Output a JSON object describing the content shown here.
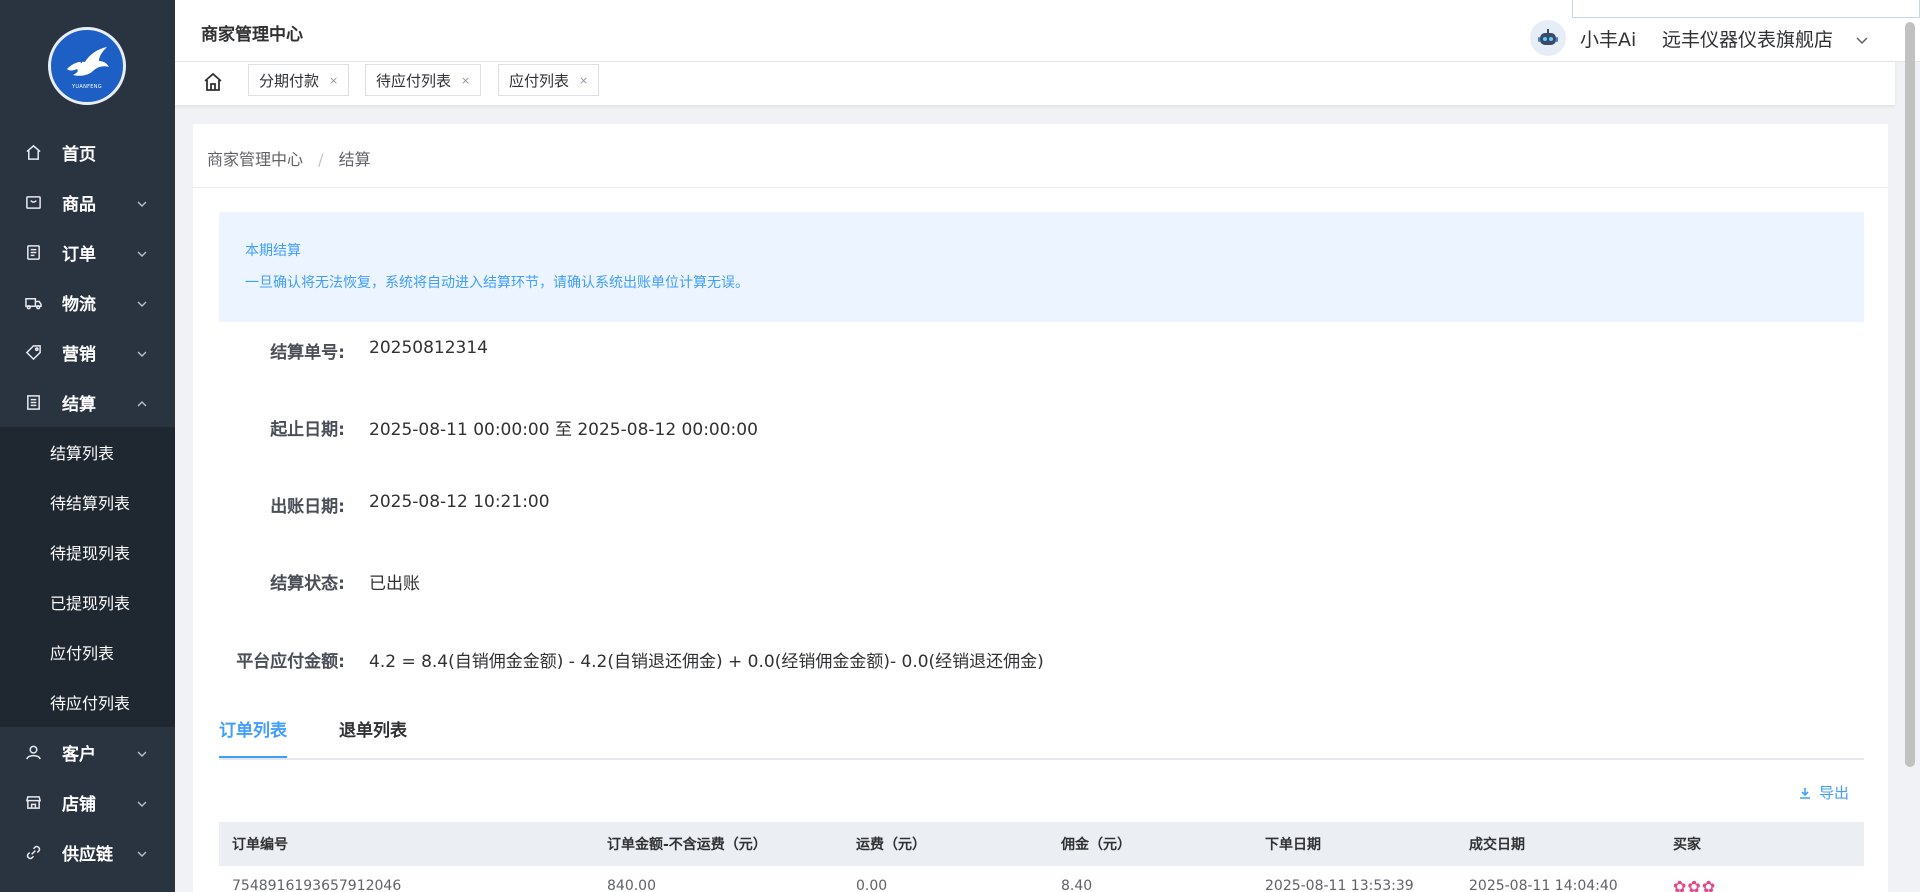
{
  "header": {
    "title": "商家管理中心",
    "ai_label": "小丰Ai",
    "store_name": "远丰仪器仪表旗舰店"
  },
  "logo": {
    "text": "YUANFENG"
  },
  "sidebar": {
    "items": [
      {
        "label": "首页",
        "icon": "home-icon"
      },
      {
        "label": "商品",
        "icon": "product-icon"
      },
      {
        "label": "订单",
        "icon": "order-icon"
      },
      {
        "label": "物流",
        "icon": "truck-icon"
      },
      {
        "label": "营销",
        "icon": "tag-icon"
      },
      {
        "label": "结算",
        "icon": "settlement-icon",
        "expanded": true
      },
      {
        "label": "客户",
        "icon": "user-icon"
      },
      {
        "label": "店铺",
        "icon": "store-icon"
      },
      {
        "label": "供应链",
        "icon": "link-icon"
      }
    ],
    "settlement_sub": [
      "结算列表",
      "待结算列表",
      "待提现列表",
      "已提现列表",
      "应付列表",
      "待应付列表"
    ]
  },
  "tabs_bar": {
    "tags": [
      "分期付款",
      "待应付列表",
      "应付列表"
    ],
    "close_glyph": "×"
  },
  "breadcrumb": {
    "root": "商家管理中心",
    "sep": "/",
    "current": "结算"
  },
  "alert": {
    "title": "本期结算",
    "description": "一旦确认将无法恢复，系统将自动进入结算环节，请确认系统出账单位计算无误。"
  },
  "details": {
    "settlement_no_label": "结算单号:",
    "settlement_no": "20250812314",
    "period_label": "起止日期:",
    "period": "2025-08-11 00:00:00 至 2025-08-12 00:00:00",
    "bill_date_label": "出账日期:",
    "bill_date": "2025-08-12 10:21:00",
    "status_label": "结算状态:",
    "status": "已出账",
    "payable_label": "平台应付金额:",
    "payable": "4.2 = 8.4(自销佣金金额) - 4.2(自销退还佣金) + 0.0(经销佣金金额)- 0.0(经销退还佣金)"
  },
  "content_tabs": {
    "active": "订单列表",
    "inactive": "退单列表"
  },
  "export_label": "导出",
  "table": {
    "headers": [
      "订单编号",
      "订单金额-不含运费（元）",
      "运费（元）",
      "佣金（元）",
      "下单日期",
      "成交日期",
      "买家"
    ],
    "rows": [
      [
        "7548916193657912046",
        "840.00",
        "0.00",
        "8.40",
        "2025-08-11 13:53:39",
        "2025-08-11 14:04:40",
        "✿✿✿"
      ]
    ]
  },
  "colors": {
    "accent": "#409eff",
    "sidebar_bg": "#2a3340",
    "submenu_bg": "#1f2731",
    "alert_bg": "#ecf5ff"
  }
}
